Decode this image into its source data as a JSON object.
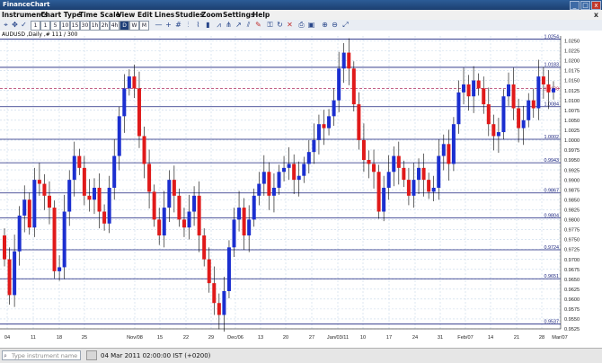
{
  "window": {
    "title": "FinanceChart",
    "controls": [
      "_",
      "□",
      "x"
    ]
  },
  "menu": {
    "items": [
      "Instruments",
      "Chart Type",
      "Time Scale",
      "View",
      "Edit",
      "Lines",
      "Studies",
      "Zoom",
      "Settings",
      "Help"
    ],
    "close_label": "x"
  },
  "toolbar": {
    "timeframes": [
      "1",
      "1",
      "5",
      "10",
      "15",
      "30",
      "1h",
      "2h",
      "4h",
      "D",
      "W",
      "M"
    ],
    "selected": "D"
  },
  "chart": {
    "label": "AUDUSD ,Daily ,# 111 / 300",
    "price_levels": [
      "1.0254",
      "1.0183",
      "1.0084",
      "1.0002",
      "0.9943",
      "0.9867",
      "0.9804",
      "0.9724",
      "0.9651",
      "0.9537"
    ],
    "current_price": "1.0130",
    "axis_ticks": [
      "1.0250",
      "1.0225",
      "1.0200",
      "1.0175",
      "1.0150",
      "1.0125",
      "1.0100",
      "1.0075",
      "1.0050",
      "1.0025",
      "1.0000",
      "0.9975",
      "0.9950",
      "0.9925",
      "0.9900",
      "0.9875",
      "0.9850",
      "0.9825",
      "0.9800",
      "0.9775",
      "0.9750",
      "0.9725",
      "0.9700",
      "0.9675",
      "0.9650",
      "0.9625",
      "0.9600",
      "0.9575",
      "0.9550",
      "0.9525"
    ],
    "date_labels": [
      "04",
      "11",
      "18",
      "25",
      "Nov/08",
      "15",
      "22",
      "29",
      "Dec/06",
      "13",
      "20",
      "27",
      "Jan/03/11",
      "10",
      "17",
      "24",
      "31",
      "Feb/07",
      "14",
      "21",
      "28",
      "Mar/07"
    ],
    "colors": {
      "bull": "#1b2fd0",
      "bear": "#e01a1a",
      "level_line": "#1a237e",
      "grid": "#c6d7ea",
      "price_line": "#b03060"
    }
  },
  "status": {
    "search_placeholder": "Type instrument name",
    "datetime": "04 Mar 2011 02:00:00 IST (+0200)"
  }
}
